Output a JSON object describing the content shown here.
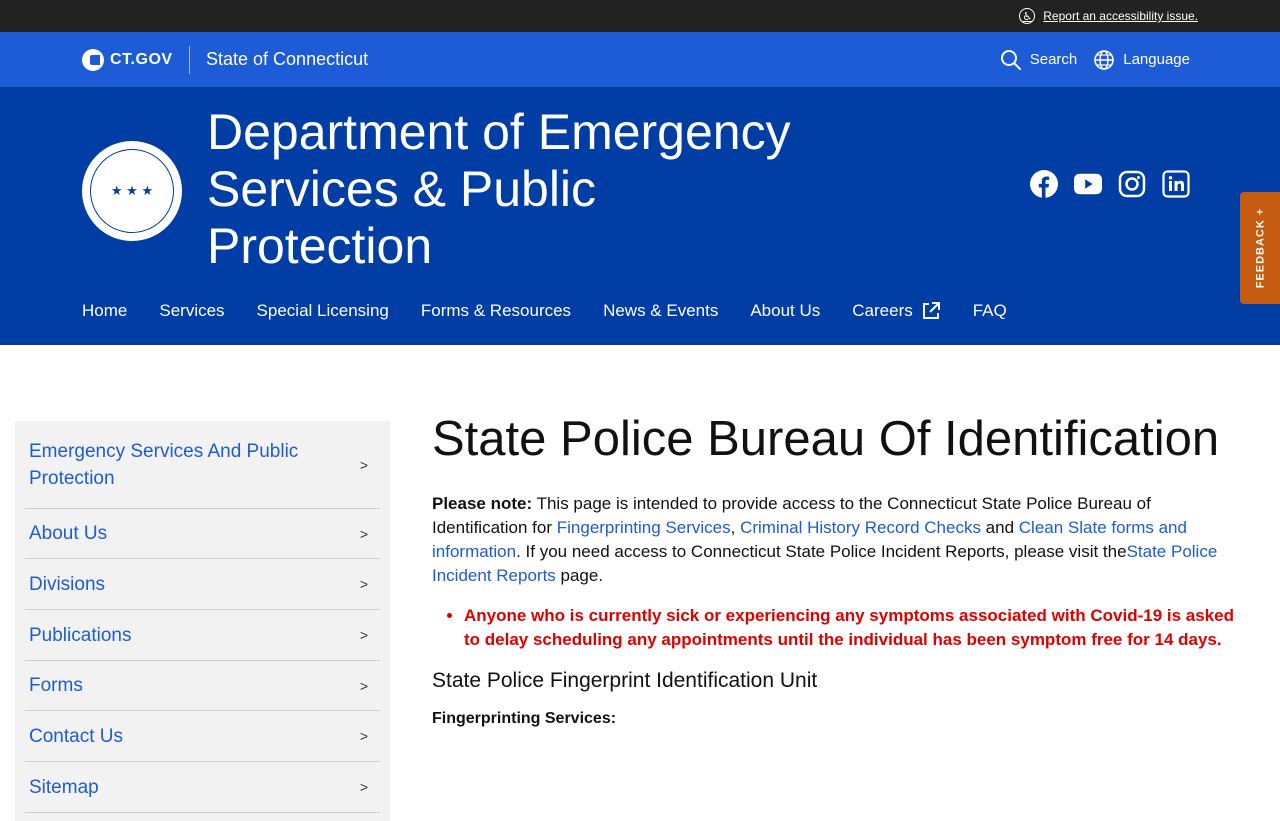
{
  "utility": {
    "accessibility_link": "Report an accessibility issue."
  },
  "state_bar": {
    "logo_text": "CT.GOV",
    "state_name": "State of Connecticut",
    "search_label": "Search",
    "language_label": "Language"
  },
  "agency": {
    "title": "Department of Emergency Services & Public Protection",
    "social": [
      "facebook-icon",
      "youtube-icon",
      "instagram-icon",
      "linkedin-icon"
    ]
  },
  "nav": {
    "items": [
      {
        "label": "Home"
      },
      {
        "label": "Services"
      },
      {
        "label": "Special Licensing"
      },
      {
        "label": "Forms & Resources"
      },
      {
        "label": "News & Events"
      },
      {
        "label": "About Us"
      },
      {
        "label": "Careers"
      },
      {
        "label": "FAQ"
      }
    ]
  },
  "feedback": {
    "label": "FEEDBACK +"
  },
  "sidebar": {
    "items": [
      {
        "label": "Emergency Services And Public Protection"
      },
      {
        "label": "About Us"
      },
      {
        "label": "Divisions"
      },
      {
        "label": "Publications"
      },
      {
        "label": "Forms"
      },
      {
        "label": "Contact Us"
      },
      {
        "label": "Sitemap"
      }
    ]
  },
  "main": {
    "title": "State Police Bureau Of Identification",
    "note_label": "Please note:",
    "intro_1": " This page is intended to provide access to the Connecticut State Police Bureau of Identification for ",
    "link_fingerprinting": "Fingerprinting Services",
    "sep_comma": ", ",
    "link_criminal": "Criminal History Record Checks",
    "sep_and": " and ",
    "link_clean_slate": "Clean Slate forms and information",
    "intro_2": ". If you need access to Connecticut State Police Incident Reports, please visit the",
    "link_incident": "State Police Incident Reports",
    "intro_3": " page.",
    "alert": "Anyone who is currently sick or experiencing any symptoms associated with Covid-19 is asked to delay scheduling any appointments until the individual has been symptom free for 14 days.",
    "subheading": "State Police Fingerprint Identification Unit",
    "sublabel": "Fingerprinting Services:"
  },
  "colors": {
    "utility_bg": "#222222",
    "state_bar_bg": "#1e5bd6",
    "agency_bg": "#003da5",
    "feedback_bg": "#c55a11",
    "link": "#1e5bd6",
    "alert": "#e00000"
  }
}
